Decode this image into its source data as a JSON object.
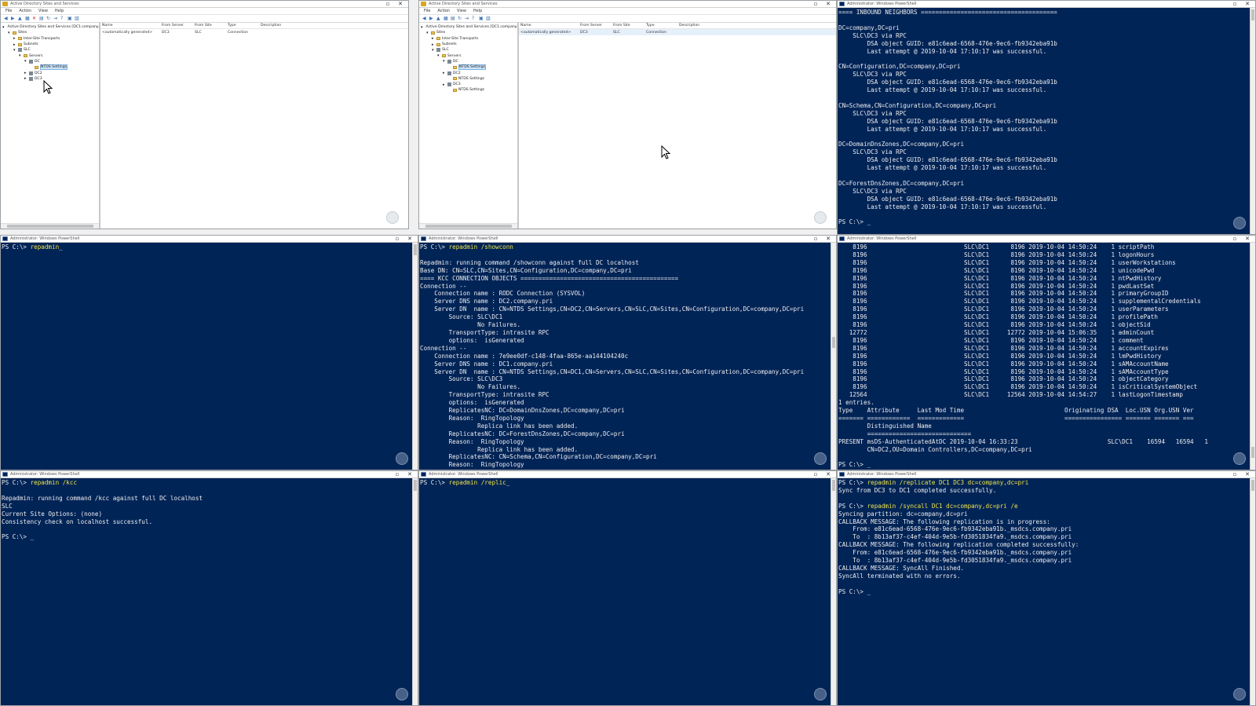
{
  "colors": {
    "console_bg": "#012456",
    "console_fg": "#eeedf0",
    "command": "#f1e44b"
  },
  "ad_window": {
    "title": "Active Directory Sites and Services",
    "menu": [
      "File",
      "Action",
      "View",
      "Help"
    ],
    "tree_root": "Active Directory Sites and Services [DC1.company.pri]",
    "list_headers": [
      "Name",
      "From Server",
      "From Site",
      "Type",
      "Description"
    ],
    "list_row": [
      "<automatically generated>",
      "DC3",
      "SLC",
      "Connection",
      ""
    ]
  },
  "ad1": {
    "tree": [
      {
        "label": "Active Directory Sites and Services [DC1.company.pri]",
        "indent": 0,
        "type": "site"
      },
      {
        "label": "Sites",
        "indent": 1,
        "type": "folder"
      },
      {
        "label": "Inter-Site Transports",
        "indent": 2,
        "type": "folder"
      },
      {
        "label": "Subnets",
        "indent": 2,
        "type": "folder"
      },
      {
        "label": "SLC",
        "indent": 2,
        "type": "site"
      },
      {
        "label": "Servers",
        "indent": 3,
        "type": "folder"
      },
      {
        "label": "DC",
        "indent": 4,
        "type": "server"
      },
      {
        "label": "NTDS Settings",
        "indent": 5,
        "type": "folder",
        "selected": true
      },
      {
        "label": "DC2",
        "indent": 4,
        "type": "server"
      },
      {
        "label": "DC3",
        "indent": 4,
        "type": "server"
      }
    ]
  },
  "ad2": {
    "tree": [
      {
        "label": "Active Directory Sites and Services [DC1.company.pri]",
        "indent": 0,
        "type": "site"
      },
      {
        "label": "Sites",
        "indent": 1,
        "type": "folder"
      },
      {
        "label": "Inter-Site Transports",
        "indent": 2,
        "type": "folder"
      },
      {
        "label": "Subnets",
        "indent": 2,
        "type": "folder"
      },
      {
        "label": "SLC",
        "indent": 2,
        "type": "site"
      },
      {
        "label": "Servers",
        "indent": 3,
        "type": "folder"
      },
      {
        "label": "DC",
        "indent": 4,
        "type": "server"
      },
      {
        "label": "NTDS Settings",
        "indent": 5,
        "type": "folder",
        "selected": true
      },
      {
        "label": "DC2",
        "indent": 4,
        "type": "server"
      },
      {
        "label": "NTDS Settings",
        "indent": 5,
        "type": "folder"
      },
      {
        "label": "DC3",
        "indent": 4,
        "type": "server"
      },
      {
        "label": "NTDS Settings",
        "indent": 5,
        "type": "folder"
      }
    ]
  },
  "ps_title": "Administrator: Windows PowerShell",
  "ps1": {
    "lines": [
      "==== INBOUND NEIGHBORS ======================================",
      "",
      "DC=company,DC=pri",
      "    SLC\\DC3 via RPC",
      "        DSA object GUID: e81c6ead-6568-476e-9ec6-fb9342eba91b",
      "        Last attempt @ 2019-10-04 17:10:17 was successful.",
      "",
      "CN=Configuration,DC=company,DC=pri",
      "    SLC\\DC3 via RPC",
      "        DSA object GUID: e81c6ead-6568-476e-9ec6-fb9342eba91b",
      "        Last attempt @ 2019-10-04 17:10:17 was successful.",
      "",
      "CN=Schema,CN=Configuration,DC=company,DC=pri",
      "    SLC\\DC3 via RPC",
      "        DSA object GUID: e81c6ead-6568-476e-9ec6-fb9342eba91b",
      "        Last attempt @ 2019-10-04 17:10:17 was successful.",
      "",
      "DC=DomainDnsZones,DC=company,DC=pri",
      "    SLC\\DC3 via RPC",
      "        DSA object GUID: e81c6ead-6568-476e-9ec6-fb9342eba91b",
      "        Last attempt @ 2019-10-04 17:10:17 was successful.",
      "",
      "DC=ForestDnsZones,DC=company,DC=pri",
      "    SLC\\DC3 via RPC",
      "        DSA object GUID: e81c6ead-6568-476e-9ec6-fb9342eba91b",
      "        Last attempt @ 2019-10-04 17:10:17 was successful.",
      "",
      {
        "p": "PS C:\\> ",
        "c": "",
        "t": "_"
      }
    ]
  },
  "ps2": {
    "lines": [
      {
        "p": "PS C:\\> ",
        "c": "repadmin",
        "t": "_"
      }
    ]
  },
  "ps3": {
    "lines": [
      {
        "p": "PS C:\\> ",
        "c": "repadmin /showconn",
        "t": ""
      },
      "",
      "Repadmin: running command /showconn against full DC localhost",
      "Base DN: CN=SLC,CN=Sites,CN=Configuration,DC=company,DC=pri",
      "==== KCC CONNECTION OBJECTS ============================================",
      "Connection --",
      "    Connection name : RODC Connection (SYSVOL)",
      "    Server DNS name : DC2.company.pri",
      "    Server DN  name : CN=NTDS Settings,CN=DC2,CN=Servers,CN=SLC,CN=Sites,CN=Configuration,DC=company,DC=pri",
      "        Source: SLC\\DC1",
      "                No Failures.",
      "        TransportType: intrasite RPC",
      "        options:  isGenerated",
      "Connection --",
      "    Connection name : 7e9ee0df-c148-4faa-865e-aa144104240c",
      "    Server DNS name : DC1.company.pri",
      "    Server DN  name : CN=NTDS Settings,CN=DC1,CN=Servers,CN=SLC,CN=Sites,CN=Configuration,DC=company,DC=pri",
      "        Source: SLC\\DC3",
      "                No Failures.",
      "        TransportType: intrasite RPC",
      "        options:  isGenerated",
      "        ReplicatesNC: DC=DomainDnsZones,DC=company,DC=pri",
      "        Reason:  RingTopology",
      "                Replica link has been added.",
      "        ReplicatesNC: DC=ForestDnsZones,DC=company,DC=pri",
      "        Reason:  RingTopology",
      "                Replica link has been added.",
      "        ReplicatesNC: CN=Schema,CN=Configuration,DC=company,DC=pri",
      "        Reason:  RingTopology"
    ]
  },
  "ps4": {
    "lines": [
      "    8196                           SLC\\DC1      8196 2019-10-04 14:50:24    1 scriptPath",
      "    8196                           SLC\\DC1      8196 2019-10-04 14:50:24    1 logonHours",
      "    8196                           SLC\\DC1      8196 2019-10-04 14:50:24    1 userWorkstations",
      "    8196                           SLC\\DC1      8196 2019-10-04 14:50:24    1 unicodePwd",
      "    8196                           SLC\\DC1      8196 2019-10-04 14:50:24    1 ntPwdHistory",
      "    8196                           SLC\\DC1      8196 2019-10-04 14:50:24    1 pwdLastSet",
      "    8196                           SLC\\DC1      8196 2019-10-04 14:50:24    1 primaryGroupID",
      "    8196                           SLC\\DC1      8196 2019-10-04 14:50:24    1 supplementalCredentials",
      "    8196                           SLC\\DC1      8196 2019-10-04 14:50:24    1 userParameters",
      "    8196                           SLC\\DC1      8196 2019-10-04 14:50:24    1 profilePath",
      "    8196                           SLC\\DC1      8196 2019-10-04 14:50:24    1 objectSid",
      "   12772                           SLC\\DC1     12772 2019-10-04 15:06:35    1 adminCount",
      "    8196                           SLC\\DC1      8196 2019-10-04 14:50:24    1 comment",
      "    8196                           SLC\\DC1      8196 2019-10-04 14:50:24    1 accountExpires",
      "    8196                           SLC\\DC1      8196 2019-10-04 14:50:24    1 lmPwdHistory",
      "    8196                           SLC\\DC1      8196 2019-10-04 14:50:24    1 sAMAccountName",
      "    8196                           SLC\\DC1      8196 2019-10-04 14:50:24    1 sAMAccountType",
      "    8196                           SLC\\DC1      8196 2019-10-04 14:50:24    1 objectCategory",
      "    8196                           SLC\\DC1      8196 2019-10-04 14:50:24    1 isCriticalSystemObject",
      "   12564                           SLC\\DC1     12564 2019-10-04 14:54:27    1 lastLogonTimestamp",
      "1 entries.",
      "Type    Attribute     Last Mod Time                            Originating DSA  Loc.USN Org.USN Ver",
      "======= ============  =============                            ================ ======= ======= ===",
      "        Distinguished Name",
      "        =============================",
      "PRESENT msDS-AuthenticatedAtDC 2019-10-04 16:33:23                         SLC\\DC1    16594   16594   1",
      "        CN=DC2,OU=Domain Controllers,DC=company,DC=pri",
      "",
      {
        "p": "PS C:\\> ",
        "c": "",
        "t": "_"
      }
    ]
  },
  "ps5": {
    "lines": [
      {
        "p": "PS C:\\> ",
        "c": "repadmin /kcc",
        "t": ""
      },
      "",
      "Repadmin: running command /kcc against full DC localhost",
      "SLC",
      "Current Site Options: (none)",
      "Consistency check on localhost successful.",
      "",
      {
        "p": "PS C:\\> ",
        "c": "",
        "t": "_"
      }
    ]
  },
  "ps6": {
    "lines": [
      {
        "p": "PS C:\\> ",
        "c": "repadmin /replic",
        "t": "_"
      }
    ]
  },
  "ps7": {
    "lines": [
      {
        "p": "PS C:\\> ",
        "c": "repadmin /replicate DC1 DC3 dc=company,dc=pri",
        "t": ""
      },
      "Sync from DC3 to DC1 completed successfully.",
      "",
      {
        "p": "PS C:\\> ",
        "c": "repadmin /syncall DC1 dc=company,dc=pri /e",
        "t": ""
      },
      "Syncing partition: dc=company,dc=pri",
      "CALLBACK MESSAGE: The following replication is in progress:",
      "    From: e81c6ead-6568-476e-9ec6-fb9342eba91b._msdcs.company.pri",
      "    To  : 8b13af37-c4ef-404d-9e5b-fd3051834fa9._msdcs.company.pri",
      "CALLBACK MESSAGE: The following replication completed successfully:",
      "    From: e81c6ead-6568-476e-9ec6-fb9342eba91b._msdcs.company.pri",
      "    To  : 8b13af37-c4ef-404d-9e5b-fd3051834fa9._msdcs.company.pri",
      "CALLBACK MESSAGE: SyncAll Finished.",
      "SyncAll terminated with no errors.",
      "",
      {
        "p": "PS C:\\> ",
        "c": "",
        "t": "_"
      }
    ]
  }
}
